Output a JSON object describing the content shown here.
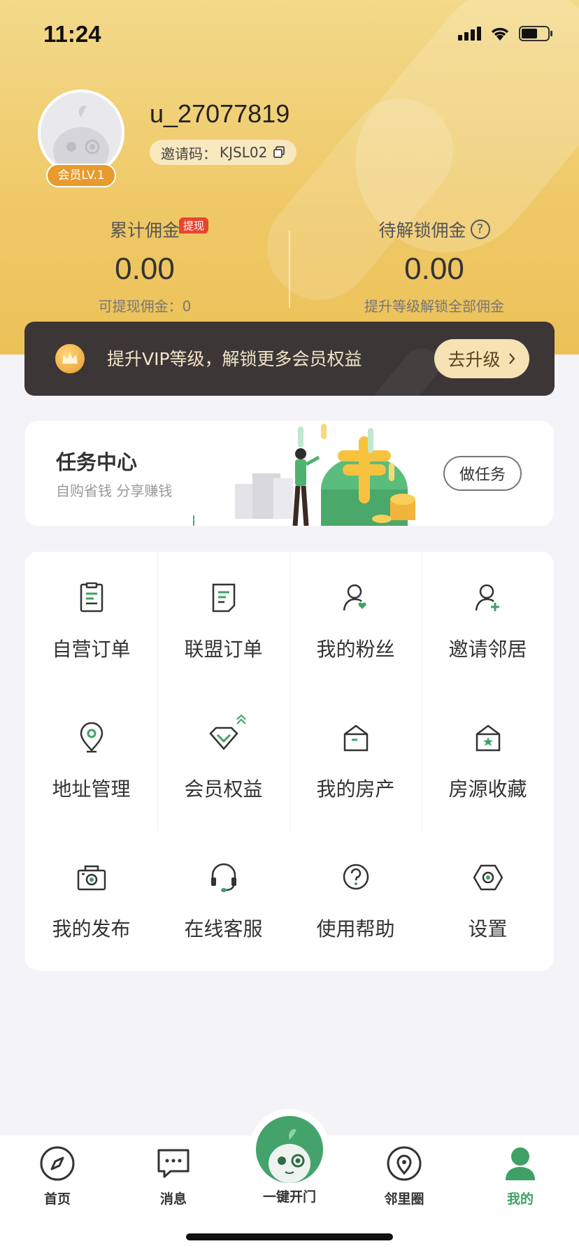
{
  "status_bar": {
    "time": "11:24"
  },
  "profile": {
    "username": "u_27077819",
    "level_badge": "会员LV.1",
    "invite_label": "邀请码：",
    "invite_code": "KJSL02"
  },
  "stats": {
    "left": {
      "label": "累计佣金",
      "badge": "提现",
      "value": "0.00",
      "sub": "可提现佣金：0"
    },
    "right": {
      "label": "待解锁佣金",
      "help_icon": "?",
      "value": "0.00",
      "sub": "提升等级解锁全部佣金"
    }
  },
  "vip_bar": {
    "text": "提升VIP等级，解锁更多会员权益",
    "button": "去升级"
  },
  "task_center": {
    "title": "任务中心",
    "subtitle": "自购省钱 分享赚钱",
    "button": "做任务"
  },
  "menu": [
    {
      "label": "自营订单",
      "icon": "order-doc-icon"
    },
    {
      "label": "联盟订单",
      "icon": "alliance-doc-icon"
    },
    {
      "label": "我的粉丝",
      "icon": "fans-icon"
    },
    {
      "label": "邀请邻居",
      "icon": "invite-user-icon"
    },
    {
      "label": "地址管理",
      "icon": "location-pin-icon"
    },
    {
      "label": "会员权益",
      "icon": "diamond-icon"
    },
    {
      "label": "我的房产",
      "icon": "house-icon"
    },
    {
      "label": "房源收藏",
      "icon": "house-star-icon"
    },
    {
      "label": "我的发布",
      "icon": "camera-icon"
    },
    {
      "label": "在线客服",
      "icon": "headset-icon"
    },
    {
      "label": "使用帮助",
      "icon": "help-icon"
    },
    {
      "label": "设置",
      "icon": "settings-hex-icon"
    }
  ],
  "tabbar": {
    "home": "首页",
    "messages": "消息",
    "center": "一键开门",
    "neighbors": "邻里圈",
    "mine": "我的"
  },
  "colors": {
    "accent_green": "#3fa165",
    "header_gold": "#efc866",
    "vip_dark": "#3c3636"
  }
}
